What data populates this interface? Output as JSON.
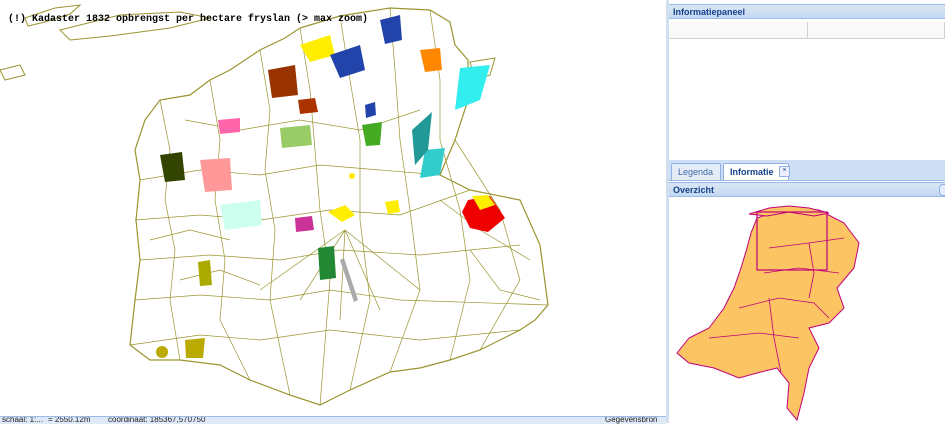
{
  "map": {
    "title": "(!) Kadaster 1832 opbrengst per hectare fryslan (> max zoom)",
    "colors": {
      "boundary": "#9b9430",
      "red": "#ee0000",
      "yellow": "#ffee00",
      "cyan": "#33eeee",
      "blue": "#2244aa",
      "orange": "#ff8800",
      "brown": "#993300",
      "green": "#228833"
    }
  },
  "statusbar": {
    "scale_label": "schaal: 1:...",
    "scale_value": "= 2550.12m",
    "coord_label": "coordinaat: 185367,570750",
    "right_label": "Gegevensbron"
  },
  "panels": {
    "info_title": "Informatiepaneel",
    "overview_title": "Overzicht"
  },
  "tabs": [
    {
      "label": "Legenda",
      "active": false
    },
    {
      "label": "Informatie",
      "active": true
    }
  ],
  "tab_close_glyph": "×",
  "overview": {
    "fill": "#fcc463",
    "stroke": "#c2007a"
  }
}
